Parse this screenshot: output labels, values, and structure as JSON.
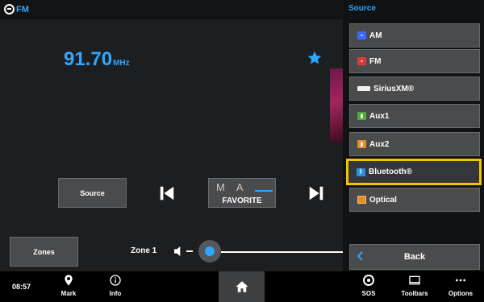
{
  "header": {
    "mode_label": "FM"
  },
  "station": {
    "frequency": "91.70",
    "unit": "MHz"
  },
  "controls": {
    "source_label": "Source",
    "favorite": {
      "slots": [
        "M",
        "A"
      ],
      "label": "FAVORITE"
    }
  },
  "zone": {
    "zones_label": "Zones",
    "zone_label": "Zone 1",
    "volume_level": 0
  },
  "source_panel": {
    "title": "Source",
    "items": [
      {
        "label": "AM",
        "icon": "am-icon"
      },
      {
        "label": "FM",
        "icon": "fm-icon"
      },
      {
        "label": "SiriusXM®",
        "icon": "siriusxm-icon"
      },
      {
        "label": "Aux1",
        "icon": "aux-icon"
      },
      {
        "label": "Aux2",
        "icon": "aux-icon"
      },
      {
        "label": "Bluetooth®",
        "icon": "bluetooth-icon",
        "selected": true
      },
      {
        "label": "Optical",
        "icon": "optical-icon"
      }
    ],
    "back_label": "Back"
  },
  "bottom_bar": {
    "clock": "08:57",
    "mark_label": "Mark",
    "info_label": "Info",
    "sos_label": "SOS",
    "toolbars_label": "Toolbars",
    "options_label": "Options"
  },
  "colors": {
    "accent": "#2fa6ff",
    "selection": "#f5c400",
    "button": "#4a4b4d"
  }
}
